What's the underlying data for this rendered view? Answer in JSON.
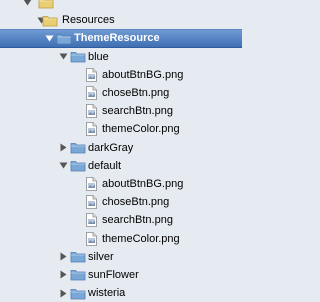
{
  "tree": {
    "rows": [
      {
        "label": "",
        "level": 0,
        "type": "folder-yellow",
        "toggle": "open"
      },
      {
        "label": "Resources",
        "level": 1,
        "type": "folder-yellow",
        "toggle": "open"
      },
      {
        "label": "ThemeResource",
        "level": 2,
        "type": "folder-blue",
        "toggle": "open",
        "selected": true
      },
      {
        "label": "blue",
        "level": 3,
        "type": "folder-blue",
        "toggle": "open"
      },
      {
        "label": "aboutBtnBG.png",
        "level": 4,
        "type": "file-png"
      },
      {
        "label": "choseBtn.png",
        "level": 4,
        "type": "file-png"
      },
      {
        "label": "searchBtn.png",
        "level": 4,
        "type": "file-png"
      },
      {
        "label": "themeColor.png",
        "level": 4,
        "type": "file-png"
      },
      {
        "label": "darkGray",
        "level": 3,
        "type": "folder-blue",
        "toggle": "closed"
      },
      {
        "label": "default",
        "level": 3,
        "type": "folder-blue",
        "toggle": "open"
      },
      {
        "label": "aboutBtnBG.png",
        "level": 4,
        "type": "file-png"
      },
      {
        "label": "choseBtn.png",
        "level": 4,
        "type": "file-png"
      },
      {
        "label": "searchBtn.png",
        "level": 4,
        "type": "file-png"
      },
      {
        "label": "themeColor.png",
        "level": 4,
        "type": "file-png"
      },
      {
        "label": "silver",
        "level": 3,
        "type": "folder-blue",
        "toggle": "closed"
      },
      {
        "label": "sunFlower",
        "level": 3,
        "type": "folder-blue",
        "toggle": "closed"
      },
      {
        "label": "wisteria",
        "level": 3,
        "type": "folder-blue",
        "toggle": "closed"
      }
    ]
  },
  "colors": {
    "background": "#e6ebf1",
    "selection": "#4a7bc0",
    "folder_blue": "#7aa7d6",
    "folder_yellow": "#e9cf72"
  }
}
